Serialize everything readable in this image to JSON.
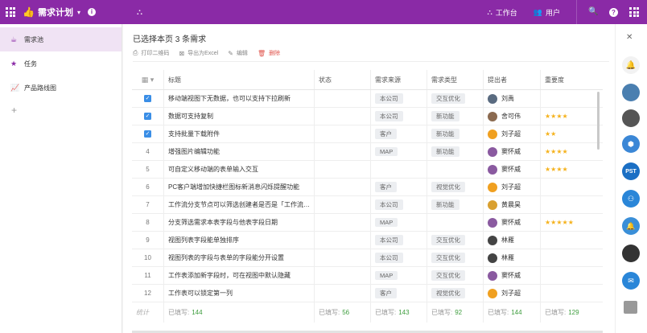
{
  "topbar": {
    "app_title": "需求计划",
    "workbench_label": "工作台",
    "users_label": "用户"
  },
  "sidebar": {
    "items": [
      {
        "label": "需求池",
        "icon": "cup-icon"
      },
      {
        "label": "任务",
        "icon": "star-icon"
      },
      {
        "label": "产品路线图",
        "icon": "roadmap-icon"
      }
    ],
    "add_label": "+"
  },
  "main": {
    "selection_title": "已选择本页 3 条需求",
    "toolbar": {
      "print_label": "打印二维码",
      "export_label": "导出为Excel",
      "edit_label": "编辑",
      "delete_label": "删除"
    },
    "columns": {
      "title": "标题",
      "status": "状态",
      "source": "需求来源",
      "type": "需求类型",
      "proposer": "提出者",
      "importance": "重要度"
    },
    "rows": [
      {
        "checked": true,
        "num": "1",
        "title": "移动端视图下无数据，也可以支持下拉刷新",
        "source": "本公司",
        "type": "交互优化",
        "proposer": "刘禹",
        "avatar_color": "#5a6b80",
        "stars": ""
      },
      {
        "checked": true,
        "num": "2",
        "title": "数据可支持复制",
        "source": "本公司",
        "type": "新功能",
        "proposer": "舍可伟",
        "avatar_color": "#8b6a50",
        "stars": "★★★★"
      },
      {
        "checked": true,
        "num": "3",
        "title": "支持批量下载附件",
        "source": "客户",
        "type": "新功能",
        "proposer": "刘子超",
        "avatar_color": "#f0a020",
        "stars": "★★"
      },
      {
        "checked": false,
        "num": "4",
        "title": "增强图片编辑功能",
        "source": "MAP",
        "type": "新功能",
        "proposer": "窦怀威",
        "avatar_color": "#8a5aa0",
        "stars": "★★★★"
      },
      {
        "checked": false,
        "num": "5",
        "title": "可自定义移动端的表单输入交互",
        "source": "",
        "type": "",
        "proposer": "窦怀威",
        "avatar_color": "#8a5aa0",
        "stars": "★★★★"
      },
      {
        "checked": false,
        "num": "6",
        "title": "PC客户端增加快捷栏图标新消息闪烁提醒功能",
        "source": "客户",
        "type": "视觉优化",
        "proposer": "刘子超",
        "avatar_color": "#f0a020",
        "stars": ""
      },
      {
        "checked": false,
        "num": "7",
        "title": "工作流分支节点可以筛选创建者是否是「工作流…",
        "source": "本公司",
        "type": "新功能",
        "proposer": "黄晨昊",
        "avatar_color": "#d9a030",
        "stars": ""
      },
      {
        "checked": false,
        "num": "8",
        "title": "分支筛选需求本表字段与他表字段日期",
        "source": "MAP",
        "type": "",
        "proposer": "窦怀威",
        "avatar_color": "#8a5aa0",
        "stars": "★★★★★"
      },
      {
        "checked": false,
        "num": "9",
        "title": "视图列表字段能单独排序",
        "source": "本公司",
        "type": "交互优化",
        "proposer": "林雁",
        "avatar_color": "#444444",
        "stars": ""
      },
      {
        "checked": false,
        "num": "10",
        "title": "视图列表的字段与表单的字段能分开设置",
        "source": "本公司",
        "type": "交互优化",
        "proposer": "林雁",
        "avatar_color": "#444444",
        "stars": ""
      },
      {
        "checked": false,
        "num": "11",
        "title": "工作表添加新字段时，可在视图中默认隐藏",
        "source": "MAP",
        "type": "交互优化",
        "proposer": "窦怀威",
        "avatar_color": "#8a5aa0",
        "stars": ""
      },
      {
        "checked": false,
        "num": "12",
        "title": "工作表可以锁定第一列",
        "source": "客户",
        "type": "视觉优化",
        "proposer": "刘子超",
        "avatar_color": "#f0a020",
        "stars": ""
      }
    ],
    "footer": {
      "total_label": "统计",
      "filled_prefix": "已填写:",
      "title_count": "144",
      "status_count": "56",
      "source_count": "143",
      "type_count": "92",
      "proposer_count": "144",
      "importance_count": "129"
    }
  },
  "rightbar": {
    "pst_label": "PST"
  }
}
